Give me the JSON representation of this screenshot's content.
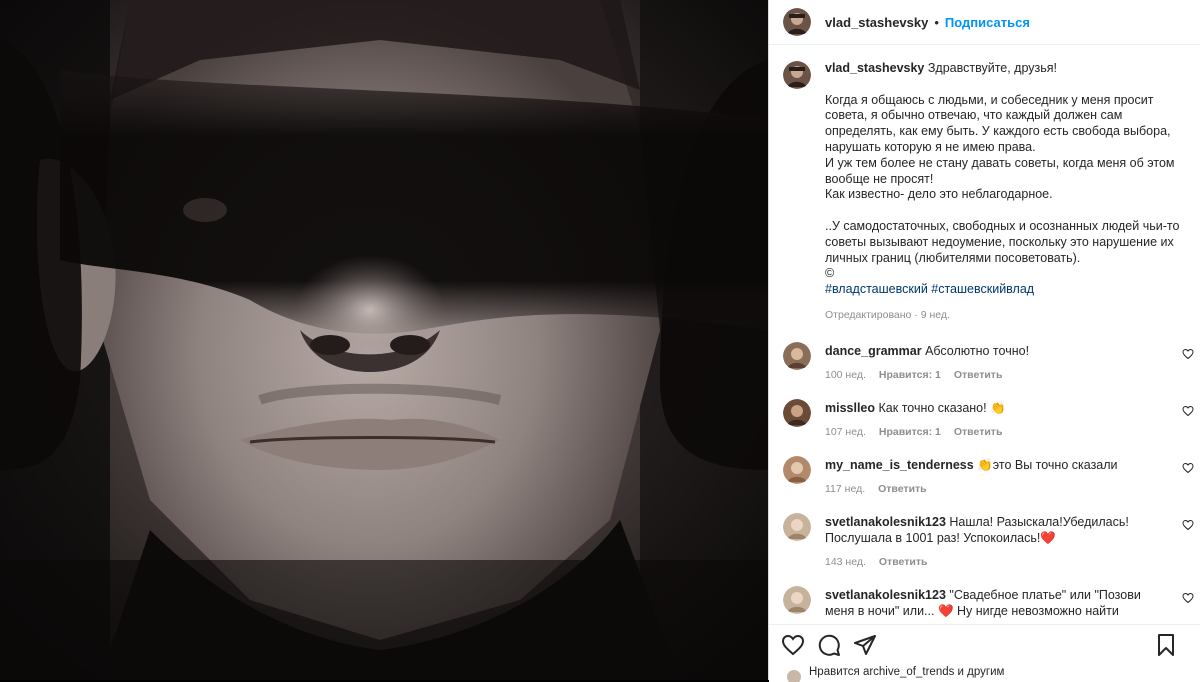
{
  "post": {
    "username": "vlad_stashevsky",
    "separator": "•",
    "follow_label": "Подписаться"
  },
  "caption": {
    "username": "vlad_stashevsky",
    "first_line": "Здравствуйте, друзья!",
    "para1": "Когда я общаюсь с людьми, и собеседник у меня просит совета, я обычно отвечаю, что каждый должен сам определять, как ему быть. У каждого есть свобода выбора, нарушать которую я не имею права.",
    "para2": "И уж тем более не стану давать советы, когда меня об этом вообще не просят!",
    "para3": "Как известно- дело это неблагодарное.",
    "para4": "..У самодостаточных, свободных и осознанных людей чьи-то советы вызывают недоумение, поскольку это нарушение их личных границ (любителями посоветовать).",
    "copyright": "©",
    "hashtags": "#владсташевский #сташевскийвлад",
    "edited": "Отредактировано · 9 нед."
  },
  "comments": [
    {
      "user": "dance_grammar",
      "text": "Абсолютно точно!",
      "time": "100 нед.",
      "likes": "Нравится: 1",
      "reply": "Ответить",
      "avatar_color": "#8a6e5a"
    },
    {
      "user": "misslleo",
      "text": "Как точно сказано! 👏",
      "time": "107 нед.",
      "likes": "Нравится: 1",
      "reply": "Ответить",
      "avatar_color": "#6b4a36"
    },
    {
      "user": "my_name_is_tenderness",
      "text": "👏это Вы точно сказали",
      "time": "117 нед.",
      "likes": "",
      "reply": "Ответить",
      "avatar_color": "#b08a6a"
    },
    {
      "user": "svetlanakolesnik123",
      "text": "Нашла! Разыскала!Убедилась! Послушала в 1001 раз! Успокоилась!❤️",
      "time": "143 нед.",
      "likes": "",
      "reply": "Ответить",
      "avatar_color": "#c7b29c"
    },
    {
      "user": "svetlanakolesnik123",
      "text": "\"Свадебное платье\" или \"Позови меня в ночи\" или... ❤️ Ну нигде невозможно найти авторов",
      "time": "",
      "likes": "",
      "reply": "",
      "avatar_color": "#c7b29c"
    }
  ],
  "likes_line": "Нравится archive_of_trends и другим",
  "icons": {
    "like": "heart-icon",
    "comment": "comment-icon",
    "share": "share-icon",
    "save": "bookmark-icon"
  },
  "colors": {
    "link": "#0095f6",
    "hashtag": "#00376b",
    "muted": "#8e8e8e"
  }
}
